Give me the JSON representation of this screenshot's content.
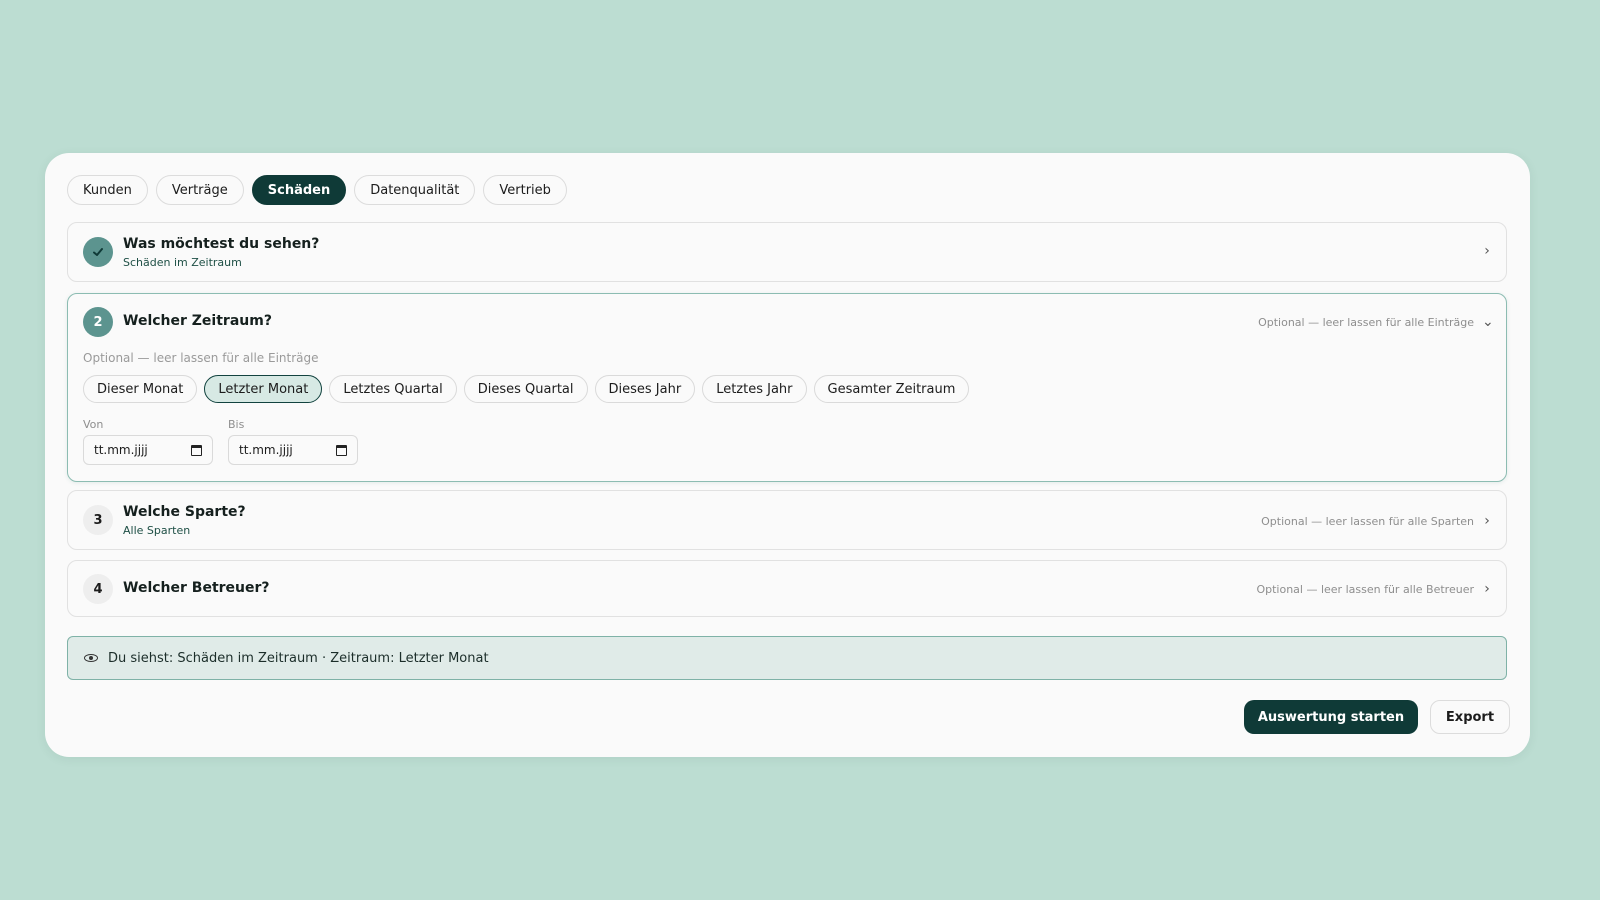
{
  "tabs": [
    {
      "label": "Kunden"
    },
    {
      "label": "Verträge"
    },
    {
      "label": "Schäden",
      "active": true
    },
    {
      "label": "Datenqualität"
    },
    {
      "label": "Vertrieb"
    }
  ],
  "steps": {
    "s1": {
      "title": "Was möchtest du sehen?",
      "value": "Schäden im Zeitraum",
      "status": "done"
    },
    "s2": {
      "number": "2",
      "title": "Welcher Zeitraum?",
      "right_hint": "Optional — leer lassen für alle Einträge",
      "hint": "Optional — leer lassen für alle Einträge",
      "presets": [
        "Dieser Monat",
        "Letzter Monat",
        "Letztes Quartal",
        "Dieses Quartal",
        "Dieses Jahr",
        "Letztes Jahr",
        "Gesamter Zeitraum"
      ],
      "selected_preset": "Letzter Monat",
      "from_label": "Von",
      "to_label": "Bis",
      "from_placeholder": "tt.mm.jjjj",
      "to_placeholder": "tt.mm.jjjj"
    },
    "s3": {
      "number": "3",
      "title": "Welche Sparte?",
      "value": "Alle Sparten",
      "right_hint": "Optional — leer lassen für alle Sparten"
    },
    "s4": {
      "number": "4",
      "title": "Welcher Betreuer?",
      "right_hint": "Optional — leer lassen für alle Betreuer"
    }
  },
  "summary": {
    "text": "Du siehst: Schäden im Zeitraum · Zeitraum: Letzter Monat",
    "icon": "eye-icon"
  },
  "actions": {
    "start_label": "Auswertung starten",
    "export_label": "Export"
  },
  "colors": {
    "background": "#bcddd2",
    "primary": "#0f3a37",
    "accent": "#5c948f",
    "selected_chip": "#d7e9e4"
  }
}
